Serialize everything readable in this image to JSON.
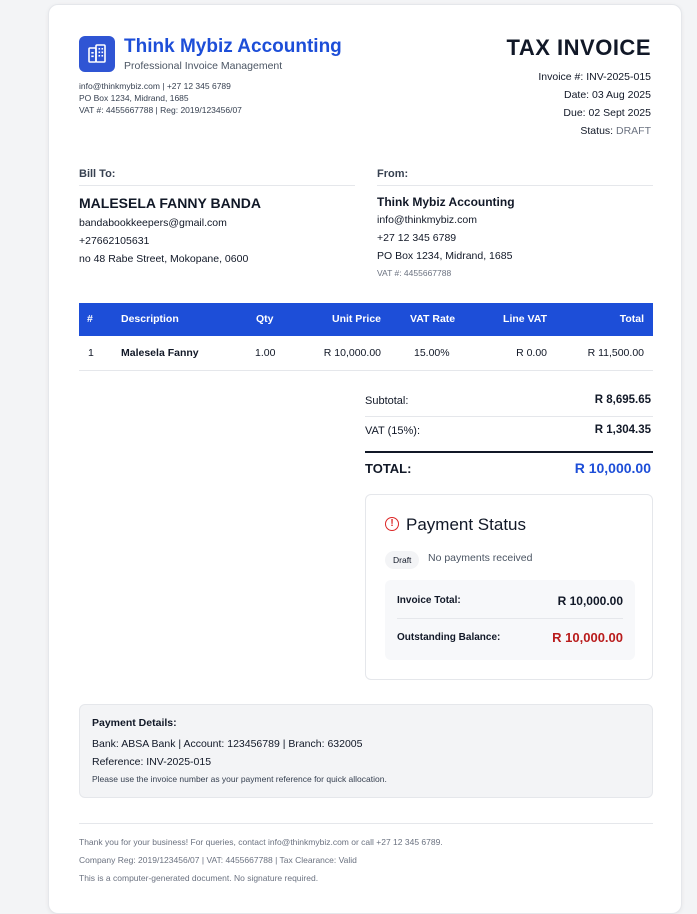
{
  "company": {
    "name": "Think Mybiz Accounting",
    "tagline": "Professional Invoice Management",
    "contact_line": "info@thinkmybiz.com | +27 12 345 6789",
    "address_line": "PO Box 1234, Midrand, 1685",
    "reg_line": "VAT #: 4455667788 | Reg: 2019/123456/07",
    "logo_icon": "building-icon",
    "brand_color": "#1d4ed8"
  },
  "invoice": {
    "title": "TAX INVOICE",
    "number_line": "Invoice #: INV-2025-015",
    "date_line": "Date: 03 Aug 2025",
    "due_line": "Due: 02 Sept 2025",
    "status_label": "Status:",
    "status_value": "DRAFT"
  },
  "bill_to": {
    "label": "Bill To:",
    "name": "MALESELA FANNY BANDA",
    "email": "bandabookkeepers@gmail.com",
    "phone": "+27662105631",
    "address": "no 48 Rabe Street, Mokopane, 0600"
  },
  "from": {
    "label": "From:",
    "name": "Think Mybiz Accounting",
    "email": "info@thinkmybiz.com",
    "phone": "+27 12 345 6789",
    "address": "PO Box 1234, Midrand, 1685",
    "vat": "VAT #: 4455667788"
  },
  "table": {
    "headers": [
      "#",
      "Description",
      "Qty",
      "Unit Price",
      "VAT Rate",
      "Line VAT",
      "Total"
    ],
    "rows": [
      [
        "1",
        "Malesela Fanny",
        "1.00",
        "R 10,000.00",
        "15.00%",
        "R 0.00",
        "R 11,500.00"
      ]
    ]
  },
  "totals": {
    "subtotal_label": "Subtotal:",
    "subtotal_value": "R 8,695.65",
    "vat_label": "VAT (15%):",
    "vat_value": "R 1,304.35",
    "total_label": "TOTAL:",
    "total_value": "R 10,000.00"
  },
  "payment_status": {
    "title": "Payment Status",
    "icon": "alert-circle-icon",
    "badge": "Draft",
    "note": "No payments received",
    "invoice_total_label": "Invoice Total:",
    "invoice_total_value": "R 10,000.00",
    "outstanding_label": "Outstanding Balance:",
    "outstanding_value": "R 10,000.00",
    "outstanding_color": "#b91c1c"
  },
  "payment_details": {
    "title": "Payment Details:",
    "bank_line": "Bank: ABSA Bank | Account: 123456789 | Branch: 632005",
    "reference_line": "Reference: INV-2025-015",
    "note": "Please use the invoice number as your payment reference for quick allocation."
  },
  "footer": {
    "line1": "Thank you for your business! For queries, contact info@thinkmybiz.com or call +27 12 345 6789.",
    "line2": "Company Reg: 2019/123456/07 | VAT: 4455667788 | Tax Clearance: Valid",
    "line3": "This is a computer-generated document. No signature required."
  }
}
